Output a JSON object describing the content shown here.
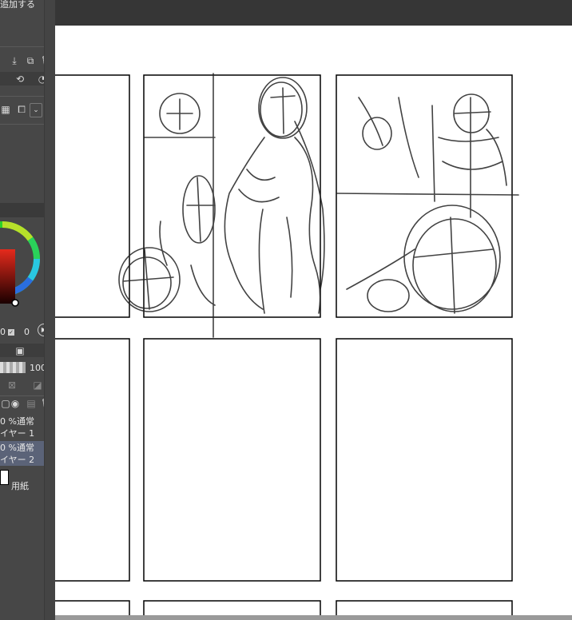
{
  "panel_top": {
    "add_label": "追加する"
  },
  "brush": {
    "opacity_value": "100"
  },
  "color_values": {
    "left": "0",
    "right": "0"
  },
  "layers": [
    {
      "blend": "0 %通常",
      "name": "イヤー 1",
      "selected": false
    },
    {
      "blend": "0 %通常",
      "name": "イヤー 2",
      "selected": true
    }
  ],
  "paper_label": "用紙",
  "colors": {
    "panel": "#474747",
    "topbar": "#363636",
    "selected_layer": "#5b6378",
    "canvas": "#ffffff",
    "frame": "#000000"
  }
}
